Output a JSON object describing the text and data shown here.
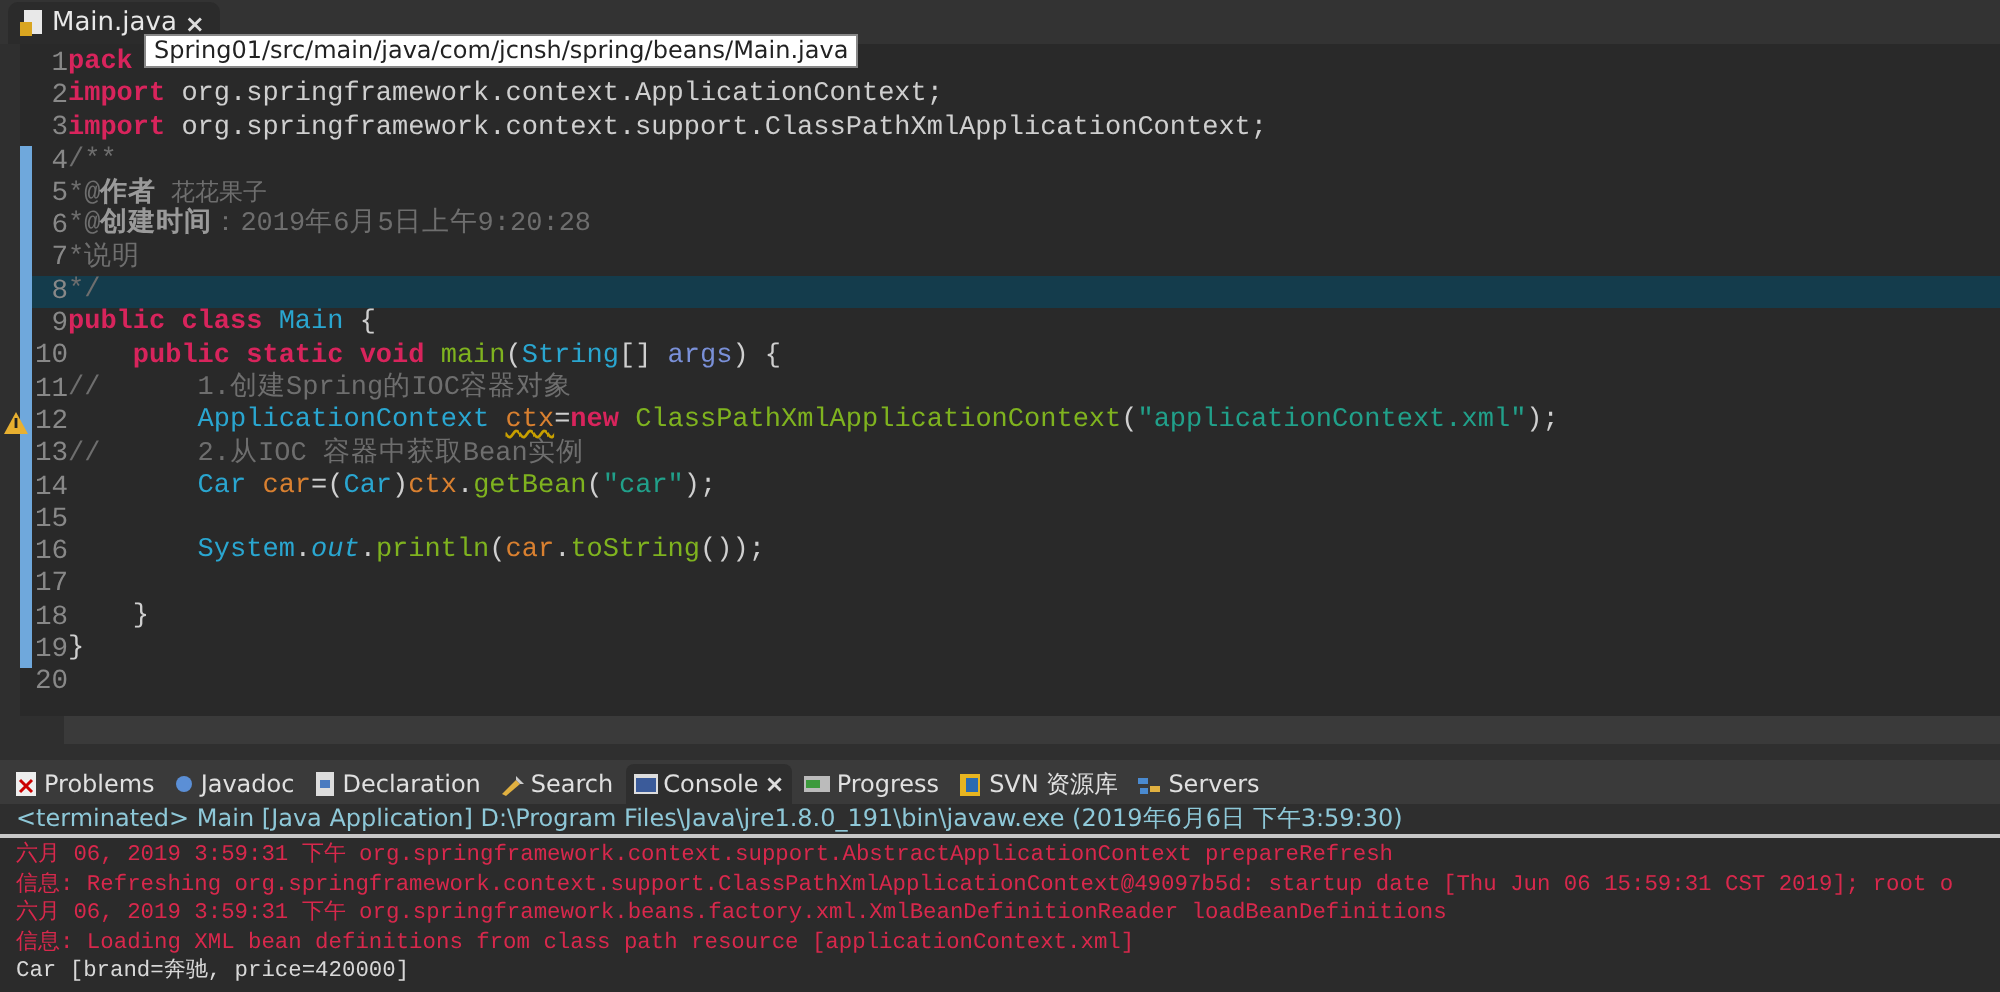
{
  "editor_tab": {
    "label": "Main.java",
    "close": "×",
    "selected": true
  },
  "tooltip": "Spring01/src/main/java/com/jcnsh/spring/beans/Main.java",
  "code_lines": [
    {
      "number": "1",
      "highlighted": false,
      "changed": false,
      "tokens": [
        {
          "kind": "kw",
          "t": "pack"
        }
      ]
    },
    {
      "number": "2",
      "highlighted": false,
      "changed": false,
      "tokens": [
        {
          "kind": "kw",
          "t": "import"
        },
        {
          "kind": "plain",
          "t": " org.springframework.context.ApplicationContext;"
        }
      ]
    },
    {
      "number": "3",
      "highlighted": false,
      "changed": false,
      "tokens": [
        {
          "kind": "kw",
          "t": "import"
        },
        {
          "kind": "plain",
          "t": " org.springframework.context.support.ClassPathXmlApplicationContext;"
        }
      ]
    },
    {
      "number": "4",
      "highlighted": false,
      "changed": true,
      "tokens": [
        {
          "kind": "comment",
          "t": "/**"
        }
      ]
    },
    {
      "number": "5",
      "highlighted": false,
      "changed": true,
      "tokens": [
        {
          "kind": "comment",
          "t": "*@"
        },
        {
          "kind": "doctag",
          "t": "作者"
        },
        {
          "kind": "docsmall",
          "t": " 花花果子"
        }
      ]
    },
    {
      "number": "6",
      "highlighted": false,
      "changed": true,
      "tokens": [
        {
          "kind": "comment",
          "t": "*@"
        },
        {
          "kind": "doctag",
          "t": "创建时间"
        },
        {
          "kind": "comment",
          "t": "：2019年6月5日上午9:20:28"
        }
      ]
    },
    {
      "number": "7",
      "highlighted": false,
      "changed": true,
      "tokens": [
        {
          "kind": "comment",
          "t": "*说明"
        }
      ]
    },
    {
      "number": "8",
      "highlighted": true,
      "changed": true,
      "tokens": [
        {
          "kind": "comment",
          "t": "*/"
        }
      ]
    },
    {
      "number": "9",
      "highlighted": false,
      "changed": true,
      "tokens": [
        {
          "kind": "kw",
          "t": "public class "
        },
        {
          "kind": "type",
          "t": "Main"
        },
        {
          "kind": "plain",
          "t": " {"
        }
      ]
    },
    {
      "number": "10",
      "highlighted": false,
      "changed": true,
      "tokens": [
        {
          "kind": "kw",
          "t": "    public static void "
        },
        {
          "kind": "method",
          "t": "main"
        },
        {
          "kind": "plain",
          "t": "("
        },
        {
          "kind": "type",
          "t": "String"
        },
        {
          "kind": "plain",
          "t": "[] "
        },
        {
          "kind": "param",
          "t": "args"
        },
        {
          "kind": "plain",
          "t": ") {"
        }
      ]
    },
    {
      "number": "11",
      "highlighted": false,
      "changed": true,
      "tokens": [
        {
          "kind": "comment",
          "t": "//      1.创建Spring的IOC容器对象"
        }
      ]
    },
    {
      "number": "12",
      "highlighted": false,
      "changed": true,
      "warning": true,
      "tokens": [
        {
          "kind": "type",
          "t": "        ApplicationContext "
        },
        {
          "kind": "varwarn",
          "t": "ctx"
        },
        {
          "kind": "plain",
          "t": "="
        },
        {
          "kind": "kw",
          "t": "new "
        },
        {
          "kind": "method",
          "t": "ClassPathXmlApplicationContext"
        },
        {
          "kind": "plain",
          "t": "("
        },
        {
          "kind": "string",
          "t": "\"applicationContext.xml\""
        },
        {
          "kind": "plain",
          "t": ");"
        }
      ]
    },
    {
      "number": "13",
      "highlighted": false,
      "changed": true,
      "tokens": [
        {
          "kind": "comment",
          "t": "//      2.从IOC 容器中获取Bean实例"
        }
      ]
    },
    {
      "number": "14",
      "highlighted": false,
      "changed": true,
      "tokens": [
        {
          "kind": "type",
          "t": "        Car "
        },
        {
          "kind": "var",
          "t": "car"
        },
        {
          "kind": "plain",
          "t": "=("
        },
        {
          "kind": "type",
          "t": "Car"
        },
        {
          "kind": "plain",
          "t": ")"
        },
        {
          "kind": "var",
          "t": "ctx"
        },
        {
          "kind": "plain",
          "t": "."
        },
        {
          "kind": "method",
          "t": "getBean"
        },
        {
          "kind": "plain",
          "t": "("
        },
        {
          "kind": "string",
          "t": "\"car\""
        },
        {
          "kind": "plain",
          "t": ");"
        }
      ]
    },
    {
      "number": "15",
      "highlighted": false,
      "changed": true
    },
    {
      "number": "16",
      "highlighted": false,
      "changed": true,
      "tokens": [
        {
          "kind": "type",
          "t": "        System"
        },
        {
          "kind": "plain",
          "t": "."
        },
        {
          "kind": "field",
          "t": "out"
        },
        {
          "kind": "plain",
          "t": "."
        },
        {
          "kind": "method",
          "t": "println"
        },
        {
          "kind": "plain",
          "t": "("
        },
        {
          "kind": "var",
          "t": "car"
        },
        {
          "kind": "plain",
          "t": "."
        },
        {
          "kind": "method",
          "t": "toString"
        },
        {
          "kind": "plain",
          "t": "());"
        }
      ]
    },
    {
      "number": "17",
      "highlighted": false,
      "changed": true
    },
    {
      "number": "18",
      "highlighted": false,
      "changed": true,
      "tokens": [
        {
          "kind": "plain",
          "t": "    }"
        }
      ]
    },
    {
      "number": "19",
      "highlighted": false,
      "changed": true,
      "tokens": [
        {
          "kind": "plain",
          "t": "}"
        }
      ]
    },
    {
      "number": "20",
      "highlighted": false,
      "changed": false
    }
  ],
  "view_tabs": [
    {
      "label": "Problems",
      "kind": "problems",
      "selected": false
    },
    {
      "label": "Javadoc",
      "kind": "javadoc",
      "selected": false
    },
    {
      "label": "Declaration",
      "kind": "declaration",
      "selected": false
    },
    {
      "label": "Search",
      "kind": "search",
      "selected": false
    },
    {
      "label": "Console",
      "kind": "console",
      "selected": true,
      "close": "×"
    },
    {
      "label": "Progress",
      "kind": "progress",
      "selected": false
    },
    {
      "label": "SVN 资源库",
      "kind": "svn",
      "selected": false
    },
    {
      "label": "Servers",
      "kind": "servers",
      "selected": false
    }
  ],
  "console": {
    "header": "<terminated> Main [Java Application] D:\\Program Files\\Java\\jre1.8.0_191\\bin\\javaw.exe (2019年6月6日 下午3:59:30)",
    "lines": [
      {
        "kind": "error",
        "text": "六月 06, 2019 3:59:31 下午 org.springframework.context.support.AbstractApplicationContext prepareRefresh"
      },
      {
        "kind": "error",
        "text": "信息: Refreshing org.springframework.context.support.ClassPathXmlApplicationContext@49097b5d: startup date [Thu Jun 06 15:59:31 CST 2019]; root o"
      },
      {
        "kind": "error",
        "text": "六月 06, 2019 3:59:31 下午 org.springframework.beans.factory.xml.XmlBeanDefinitionReader loadBeanDefinitions"
      },
      {
        "kind": "error",
        "text": "信息: Loading XML bean definitions from class path resource [applicationContext.xml]"
      },
      {
        "kind": "output",
        "text": "Car [brand=奔驰, price=420000]"
      }
    ]
  }
}
